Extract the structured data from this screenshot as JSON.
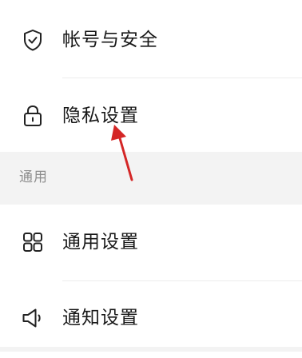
{
  "rows": {
    "account_security": {
      "label": "帐号与安全",
      "icon": "shield-check-icon"
    },
    "privacy": {
      "label": "隐私设置",
      "icon": "lock-icon"
    },
    "general": {
      "label": "通用设置",
      "icon": "grid-icon"
    },
    "notifications": {
      "label": "通知设置",
      "icon": "speaker-icon"
    }
  },
  "sections": {
    "general": {
      "title": "通用"
    }
  },
  "annotation": {
    "arrow_color": "#d42626",
    "arrow_target": "privacy"
  }
}
